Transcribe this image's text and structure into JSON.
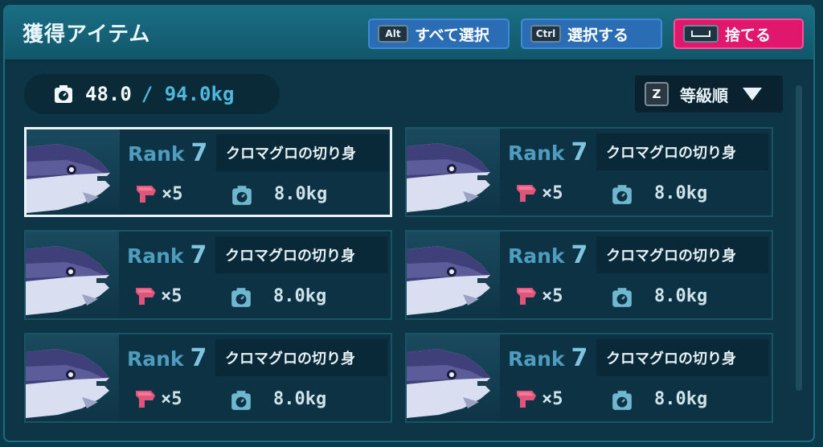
{
  "title": "獲得アイテム",
  "buttons": [
    {
      "key": "Alt",
      "label": "すべて選択"
    },
    {
      "key": "Ctrl",
      "label": "選択する"
    },
    {
      "key": "␣",
      "label": "捨てる"
    }
  ],
  "weight": {
    "current": "48.0",
    "max": "/ 94.0kg"
  },
  "sort": {
    "key": "Z",
    "label": "等級順"
  },
  "items": [
    {
      "rank_label": "Rank",
      "rank": "7",
      "name": "クロマグロの切り身",
      "qty": "×5",
      "weight": "8.0kg",
      "selected": true
    },
    {
      "rank_label": "Rank",
      "rank": "7",
      "name": "クロマグロの切り身",
      "qty": "×5",
      "weight": "8.0kg",
      "selected": false
    },
    {
      "rank_label": "Rank",
      "rank": "7",
      "name": "クロマグロの切り身",
      "qty": "×5",
      "weight": "8.0kg",
      "selected": false
    },
    {
      "rank_label": "Rank",
      "rank": "7",
      "name": "クロマグロの切り身",
      "qty": "×5",
      "weight": "8.0kg",
      "selected": false
    },
    {
      "rank_label": "Rank",
      "rank": "7",
      "name": "クロマグロの切り身",
      "qty": "×5",
      "weight": "8.0kg",
      "selected": false
    },
    {
      "rank_label": "Rank",
      "rank": "7",
      "name": "クロマグロの切り身",
      "qty": "×5",
      "weight": "8.0kg",
      "selected": false
    }
  ],
  "colors": {
    "accent": "#e0176d",
    "button": "#2a6db4",
    "panel": "#0d3546"
  }
}
